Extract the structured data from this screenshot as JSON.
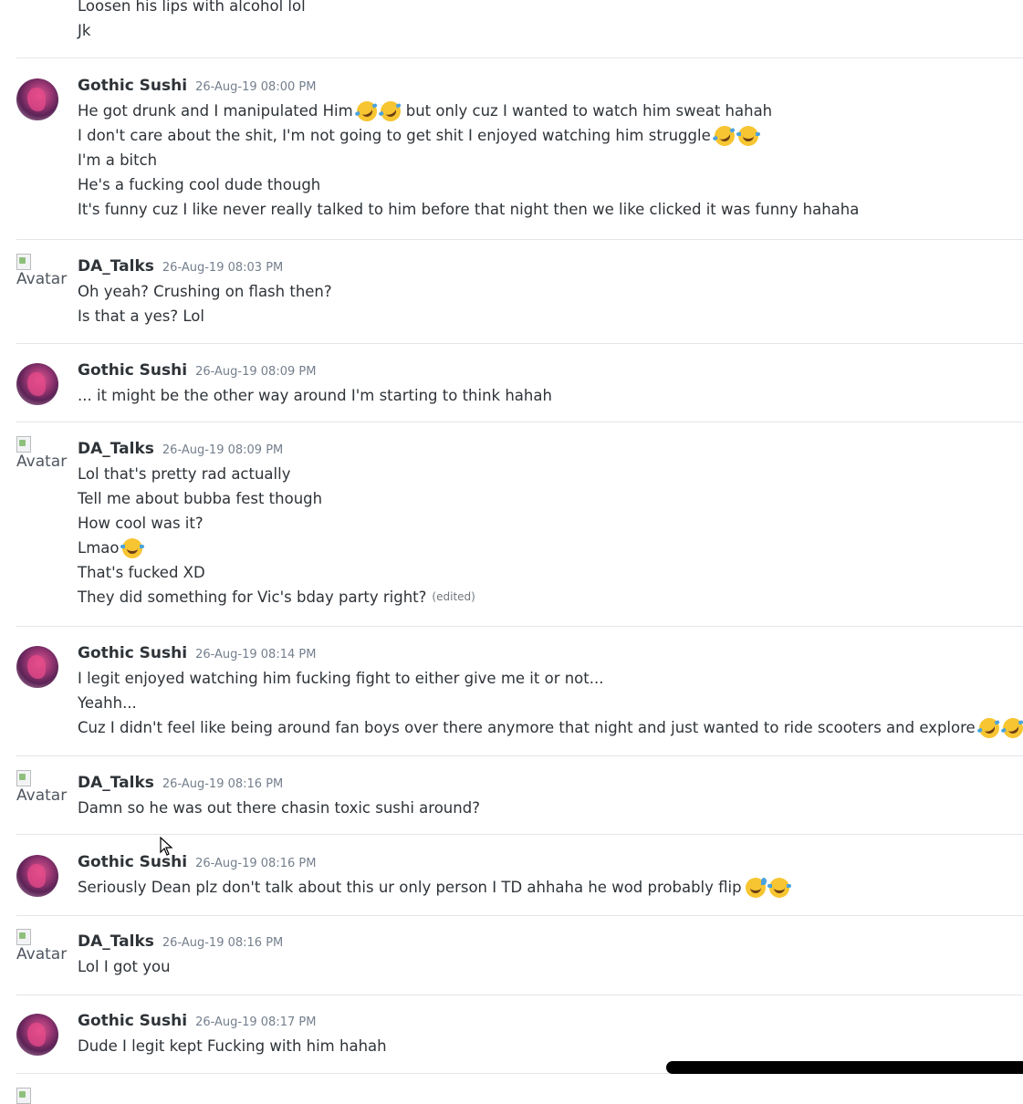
{
  "top_fragment": {
    "lines": [
      "Loosen his lips with alcohol lol",
      "Jk"
    ]
  },
  "messages": [
    {
      "author": "Gothic Sushi",
      "avatar": "image",
      "time": "26-Aug-19 08:00 PM",
      "lines": [
        {
          "text": "He got drunk and I manipulated Him",
          "emoji_after_first": [
            "rofl",
            "rofl"
          ],
          "rest": "but only cuz I wanted to watch him sweat hahah"
        },
        {
          "text": "I don't care about the shit, I'm not going to get shit I enjoyed watching him struggle",
          "emojis": [
            "rofl",
            "joy"
          ]
        },
        {
          "text": "I'm a bitch"
        },
        {
          "text": "He's a fucking cool dude though"
        },
        {
          "text": "It's funny cuz I like never really talked to him before that night then we like clicked it was funny hahaha"
        }
      ]
    },
    {
      "author": "DA_Talks",
      "avatar": "broken",
      "avatar_alt": "Avatar",
      "time": "26-Aug-19 08:03 PM",
      "lines": [
        {
          "text": "Oh yeah? Crushing on flash then?"
        },
        {
          "text": "Is that a yes? Lol"
        }
      ]
    },
    {
      "author": "Gothic Sushi",
      "avatar": "image",
      "time": "26-Aug-19 08:09 PM",
      "lines": [
        {
          "text": "... it might be the other way around I'm starting to think hahah"
        }
      ]
    },
    {
      "author": "DA_Talks",
      "avatar": "broken",
      "avatar_alt": "Avatar",
      "time": "26-Aug-19 08:09 PM",
      "lines": [
        {
          "text": "Lol that's pretty rad actually"
        },
        {
          "text": "Tell me about bubba fest though"
        },
        {
          "text": "How cool was it?"
        },
        {
          "text": "Lmao",
          "emojis": [
            "joy"
          ]
        },
        {
          "text": "That's fucked XD"
        },
        {
          "text": "They did something for Vic's bday party right?",
          "edited": "(edited)"
        }
      ]
    },
    {
      "author": "Gothic Sushi",
      "avatar": "image",
      "time": "26-Aug-19 08:14 PM",
      "lines": [
        {
          "text": "I legit enjoyed watching him fucking fight to either give me it or not..."
        },
        {
          "text": "Yeahh..."
        },
        {
          "text": "Cuz I didn't feel like being around fan boys over there anymore that night and just wanted to ride scooters and explore",
          "emojis": [
            "rofl",
            "rofl"
          ]
        }
      ]
    },
    {
      "author": "DA_Talks",
      "avatar": "broken",
      "avatar_alt": "Avatar",
      "time": "26-Aug-19 08:16 PM",
      "lines": [
        {
          "text": "Damn so he was out there chasin toxic sushi around?"
        }
      ]
    },
    {
      "author": "Gothic Sushi",
      "avatar": "image",
      "time": "26-Aug-19 08:16 PM",
      "lines": [
        {
          "text": "Seriously Dean plz don't talk about this ur only person I TD ahhaha he wod probably flip",
          "emojis": [
            "sweat",
            "joy"
          ]
        }
      ]
    },
    {
      "author": "DA_Talks",
      "avatar": "broken",
      "avatar_alt": "Avatar",
      "time": "26-Aug-19 08:16 PM",
      "lines": [
        {
          "text": "Lol I got you"
        }
      ]
    },
    {
      "author": "Gothic Sushi",
      "avatar": "image",
      "time": "26-Aug-19 08:17 PM",
      "lines": [
        {
          "text": "Dude I legit kept Fucking with him hahah"
        }
      ]
    }
  ]
}
